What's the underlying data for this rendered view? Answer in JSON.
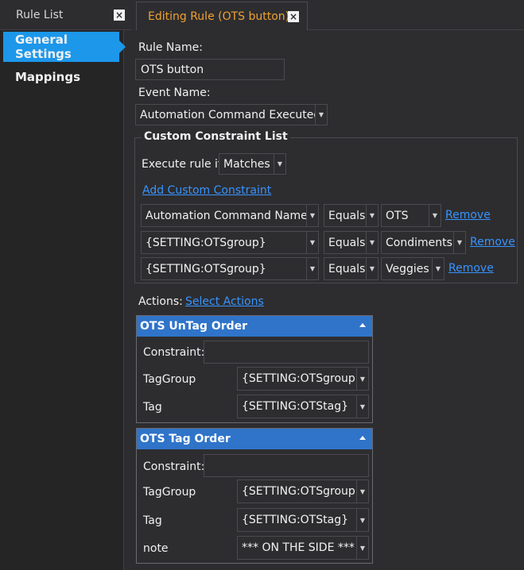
{
  "tabs": {
    "rule_list": "Rule List",
    "editing": "Editing Rule (OTS button)",
    "close_glyph": "×"
  },
  "nav": {
    "general": "General Settings",
    "mappings": "Mappings"
  },
  "form": {
    "rule_name_label": "Rule Name:",
    "rule_name_value": "OTS button",
    "event_name_label": "Event Name:",
    "event_name_value": "Automation Command Executed"
  },
  "constraints": {
    "title": "Custom Constraint List",
    "execute_label": "Execute rule if",
    "execute_value": "Matches",
    "add_link": "Add Custom Constraint",
    "rows": [
      {
        "field": "Automation Command Name",
        "op": "Equals",
        "value": "OTS",
        "remove": "Remove"
      },
      {
        "field": "{SETTING:OTSgroup}",
        "op": "Equals",
        "value": "Condiments",
        "remove": "Remove"
      },
      {
        "field": "{SETTING:OTSgroup}",
        "op": "Equals",
        "value": "Veggies",
        "remove": "Remove"
      }
    ]
  },
  "actions": {
    "label": "Actions:",
    "select_link": "Select Actions",
    "items": [
      {
        "title": "OTS UnTag Order",
        "constraint_label": "Constraint:",
        "constraint_value": "",
        "params": [
          {
            "label": "TagGroup",
            "value": "{SETTING:OTSgroup}"
          },
          {
            "label": "Tag",
            "value": "{SETTING:OTStag}"
          }
        ]
      },
      {
        "title": "OTS Tag Order",
        "constraint_label": "Constraint:",
        "constraint_value": "",
        "params": [
          {
            "label": "TagGroup",
            "value": "{SETTING:OTSgroup}"
          },
          {
            "label": "Tag",
            "value": "{SETTING:OTStag}"
          },
          {
            "label": "note",
            "value": "*** ON THE SIDE ***"
          }
        ]
      }
    ]
  },
  "colors": {
    "background": "#2d2d30",
    "accent_blue": "#1c97ea",
    "tab_active_text": "#f0a030",
    "link": "#3794ff",
    "action_header": "#2f74c9"
  }
}
